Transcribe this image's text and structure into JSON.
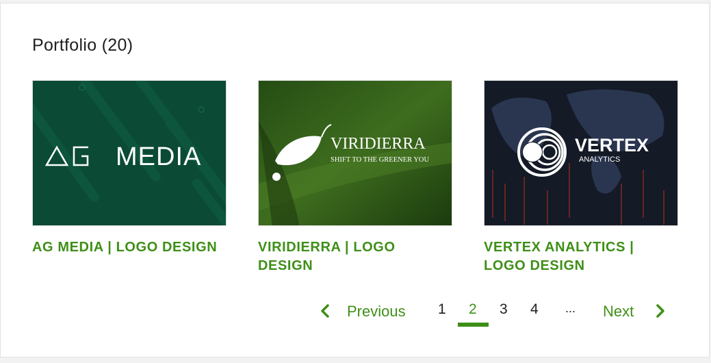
{
  "section": {
    "title": "Portfolio (20)"
  },
  "items": [
    {
      "title": "AG MEDIA | LOGO DESIGN",
      "logo_text": "MEDIA"
    },
    {
      "title": "VIRIDIERRA | LOGO DESIGN",
      "logo_text": "VIRIDIERRA",
      "tagline": "SHIFT TO THE GREENER YOU"
    },
    {
      "title": "VERTEX ANALYTICS | LOGO DESIGN",
      "logo_text": "VERTEX",
      "tagline": "ANALYTICS"
    }
  ],
  "pagination": {
    "previous_label": "Previous",
    "next_label": "Next",
    "pages": [
      "1",
      "2",
      "3",
      "4"
    ],
    "ellipsis": "...",
    "current_page": "2"
  },
  "colors": {
    "accent": "#3e8f17",
    "text": "#1f1f1f"
  },
  "icons": {
    "prev": "chevron-left-icon",
    "next": "chevron-right-icon"
  }
}
